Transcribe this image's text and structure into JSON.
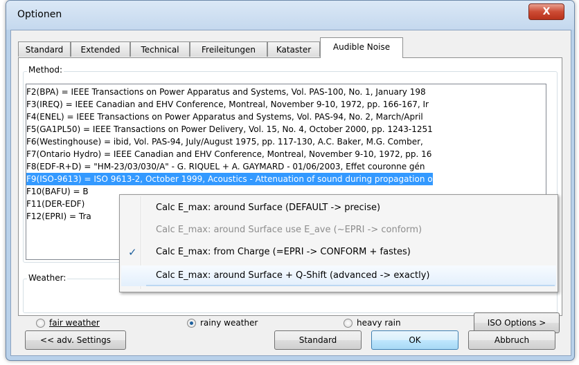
{
  "window": {
    "title": "Optionen",
    "close_glyph": "X"
  },
  "tabs": [
    "Standard",
    "Extended",
    "Technical",
    "Freileitungen",
    "Kataster",
    "Audible Noise"
  ],
  "method": {
    "label": "Method:",
    "items": [
      "F2(BPA) = IEEE Transactions on Power Apparatus and Systems, Vol. PAS-100, No. 1, January 198",
      " F3(IREQ) = IEEE Canadian and EHV Conference, Montreal, November 9-10, 1972, pp. 166-167, Ir",
      " F4(ENEL) = IEEE Transactions on Power Apparatus and Systems, Vol. PAS-94, No. 2, March/April",
      "F5(GA1PL50) = IEEE Transactions on Power Delivery, Vol. 15, No. 4, October 2000, pp. 1243-1251",
      " F6(Westinghouse) = ibid, Vol. PAS-94, July/August 1975, pp. 117-130, A.C. Baker, M.G. Comber,",
      " F7(Ontario Hydro) = IEEE Canadian and EHV Conference, Montreal, November 9-10, 1972, pp. 16",
      " F8(EDF-R+D) = \"HM-23/03/030/A\" - G. RIQUEL + A. GAYMARD - 01/06/2003, Effet couronne gén",
      "F9(ISO-9613) = ISO 9613-2, October 1999, Acoustics - Attenuation of sound during propagation o",
      " F10(BAFU) = B",
      " F11(DER-EDF)",
      "F12(EPRI) = Tra"
    ],
    "selected_index": 7
  },
  "weather": {
    "label": "Weather:",
    "options": [
      "fair weather",
      "rainy weather",
      "heavy rain"
    ],
    "selected": "rainy weather"
  },
  "iso_button": "ISO Options >",
  "footer": {
    "adv_settings": "<< adv. Settings",
    "standard": "Standard",
    "ok": "OK",
    "cancel": "Abbruch"
  },
  "context_menu": {
    "items": [
      {
        "label": "Calc E_max: around Surface (DEFAULT -> precise)",
        "enabled": true,
        "checked": false
      },
      {
        "label": "Calc E_max: around Surface use E_ave (~EPRI -> conform)",
        "enabled": false,
        "checked": false
      },
      {
        "label": "Calc E_max: from Charge (=EPRI -> CONFORM + fastes)",
        "enabled": true,
        "checked": true
      },
      {
        "label": "Calc E_max: around Surface + Q-Shift (advanced -> exactly)",
        "enabled": true,
        "checked": false,
        "hovered": true
      }
    ],
    "check_glyph": "✓"
  },
  "colors": {
    "selection": "#3399ff",
    "title_bg": "#c4d8ee",
    "close_red": "#cc4b34",
    "menu_highlight": "#bcd8f2"
  }
}
